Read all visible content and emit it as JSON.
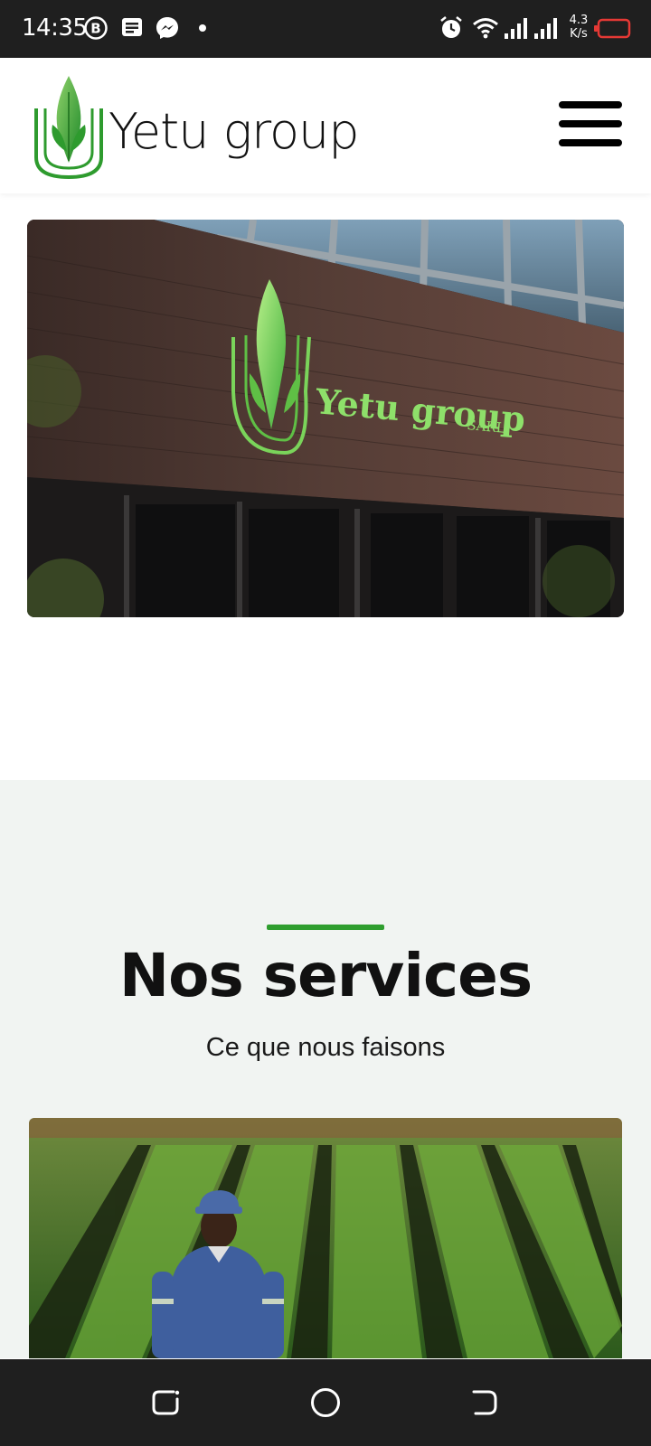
{
  "status_bar": {
    "time": "14:35",
    "network_speed_value": "4.3",
    "network_speed_unit": "K/s",
    "icons": [
      "b-circle-icon",
      "notes-icon",
      "messenger-icon",
      "dot-icon",
      "alarm-icon",
      "wifi-icon",
      "signal-icon",
      "signal-icon",
      "battery-low-icon"
    ],
    "battery_color": "#e53935"
  },
  "header": {
    "brand_name": "Yetu group",
    "menu_icon": "hamburger-menu-icon",
    "brand_color": "#2e9b2e"
  },
  "hero": {
    "sign_text": "Yetu group",
    "sign_suffix": "SARL"
  },
  "services": {
    "title": "Nos services",
    "subtitle": "Ce que nous faisons",
    "accent_color": "#2f9e2f"
  },
  "nav_bar": {
    "icons": [
      "recent-apps-icon",
      "home-circle-icon",
      "back-icon"
    ]
  }
}
